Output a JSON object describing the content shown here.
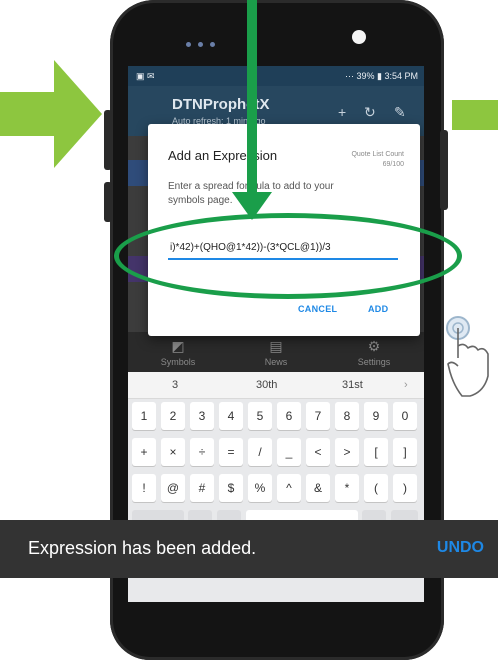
{
  "status_bar": {
    "left_icons": "▣ ✉",
    "right_text": "⋯ 39% ▮ 3:54 PM"
  },
  "app_bar": {
    "title": "DTNProphetX",
    "subtitle": "Auto refresh: 1 min ago"
  },
  "bottom_nav": [
    {
      "label": "Symbols",
      "icon": "chart-icon"
    },
    {
      "label": "News",
      "icon": "news-icon"
    },
    {
      "label": "Settings",
      "icon": "gear-icon"
    }
  ],
  "dialog": {
    "title": "Add an Expression",
    "count_label": "Quote List Count",
    "count_value": "69/100",
    "message": "Enter a spread formula to add to your symbols page.",
    "input_value": "i)*42)+(QHO@1*42))-(3*QCL@1))/3",
    "cancel_label": "CANCEL",
    "add_label": "ADD"
  },
  "keyboard": {
    "suggestions": [
      "3",
      "30th",
      "31st"
    ],
    "row1": [
      "1",
      "2",
      "3",
      "4",
      "5",
      "6",
      "7",
      "8",
      "9",
      "0"
    ],
    "row2": [
      "+",
      "×",
      "÷",
      "=",
      "/",
      "_",
      "<",
      ">",
      "[",
      "]"
    ],
    "row3": [
      "!",
      "@",
      "#",
      "$",
      "%",
      "^",
      "&",
      "*",
      "(",
      ")"
    ]
  },
  "snackbar": {
    "message": "Expression has been added.",
    "action": "UNDO"
  },
  "colors": {
    "accent": "#1e88e5",
    "annotation_green": "#1a9e4a",
    "arrow_green": "#8dc63f"
  }
}
